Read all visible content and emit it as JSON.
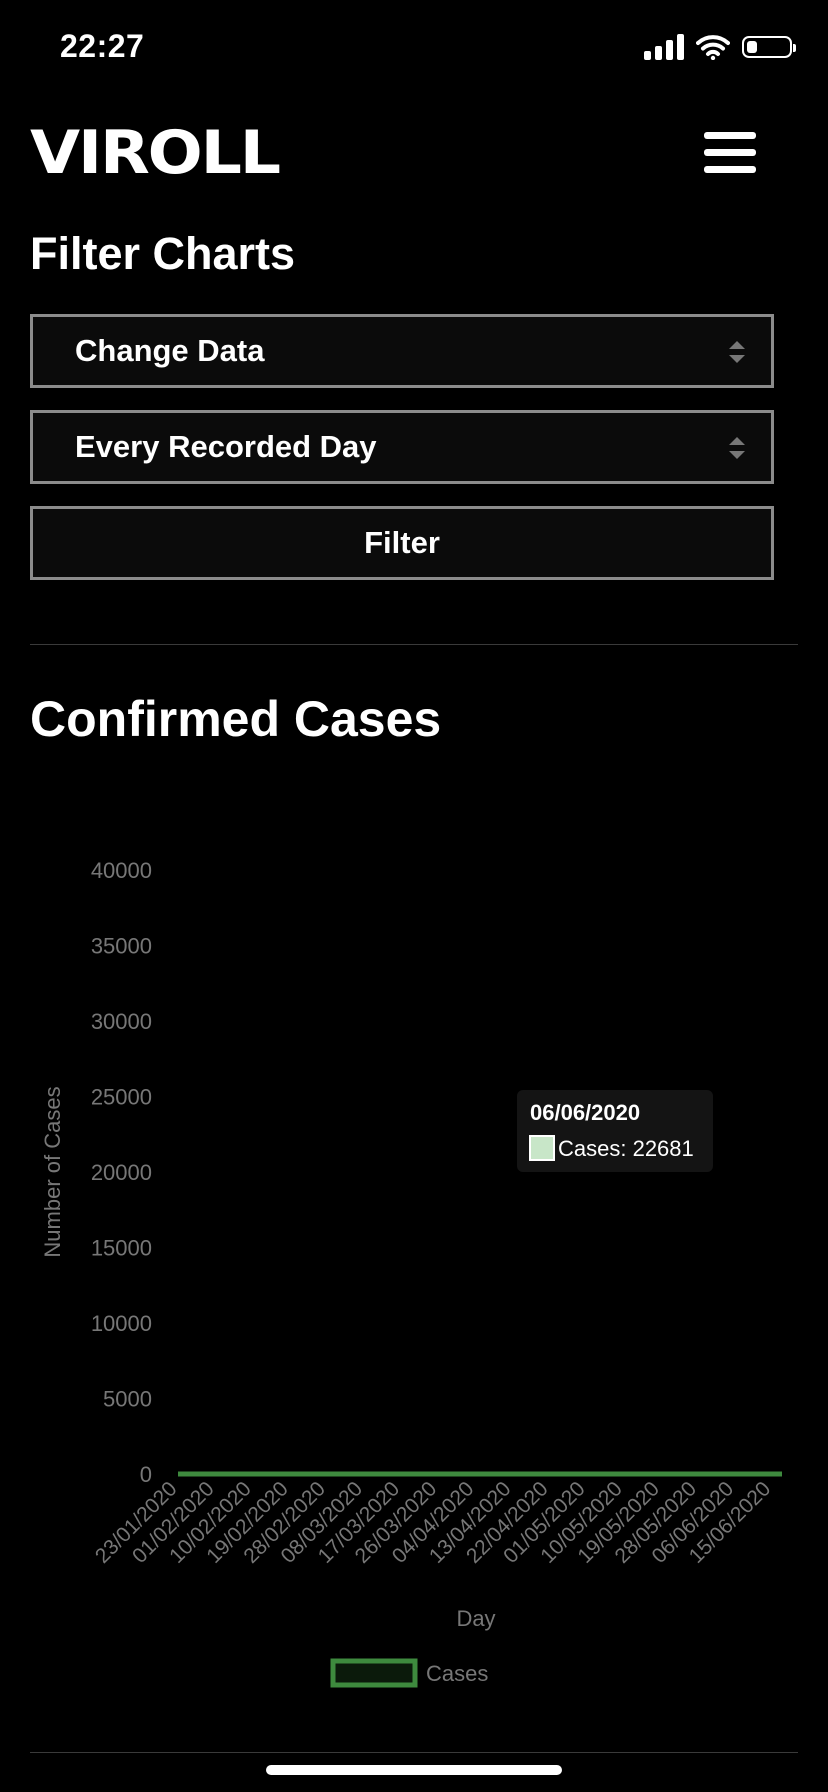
{
  "status": {
    "time": "22:27"
  },
  "header": {
    "logo": "VIROLL"
  },
  "filter": {
    "title": "Filter Charts",
    "data_select": "Change Data",
    "range_select": "Every Recorded Day",
    "button": "Filter"
  },
  "chart_title": "Confirmed Cases",
  "colors": {
    "line": "#3e8a3e",
    "fill": "#0b1a0b",
    "axis_text": "#777777",
    "tooltip_bg": "#141414"
  },
  "tooltip": {
    "date": "06/06/2020",
    "label": "Cases: 22681"
  },
  "chart_data": {
    "type": "area",
    "xlabel": "Day",
    "ylabel": "Number of Cases",
    "ylim": [
      0,
      40000
    ],
    "yticks": [
      0,
      5000,
      10000,
      15000,
      20000,
      25000,
      30000,
      35000,
      40000
    ],
    "xticks": [
      "23/01/2020",
      "01/02/2020",
      "10/02/2020",
      "19/02/2020",
      "28/02/2020",
      "08/03/2020",
      "17/03/2020",
      "26/03/2020",
      "04/04/2020",
      "13/04/2020",
      "22/04/2020",
      "01/05/2020",
      "10/05/2020",
      "19/05/2020",
      "28/05/2020",
      "06/06/2020",
      "15/06/2020"
    ],
    "grid": false,
    "legend_position": "bottom",
    "series": [
      {
        "name": "Cases",
        "x_start": "23/01/2020",
        "x_end": "18/06/2020",
        "values": [
          0,
          0,
          0,
          0,
          0,
          0,
          0,
          0,
          0,
          0,
          0,
          0,
          0,
          0,
          0,
          0,
          0,
          0,
          0,
          0,
          0,
          0,
          0,
          0,
          0,
          0,
          0,
          0,
          0,
          0,
          0,
          0,
          0,
          0,
          0,
          0,
          0,
          0,
          0,
          0,
          0,
          0,
          0,
          0,
          0,
          0,
          0,
          0,
          0,
          0,
          0,
          0,
          0,
          0,
          0,
          0,
          0,
          0,
          0,
          0,
          0,
          0,
          0,
          0,
          0,
          0,
          0,
          0,
          0,
          0,
          0,
          0,
          0,
          0,
          0,
          0,
          0,
          0,
          0,
          0,
          0,
          0,
          0,
          0,
          0,
          0,
          0,
          0,
          0,
          0,
          0,
          0,
          0,
          0,
          0,
          0,
          0,
          0,
          0,
          0,
          0,
          0,
          0,
          0,
          0,
          0,
          0,
          0,
          0,
          0,
          0,
          0,
          0,
          0,
          0,
          0,
          0,
          0,
          0,
          0,
          0,
          0,
          0,
          0,
          0,
          0,
          0,
          0,
          0,
          0,
          0,
          0,
          0,
          0,
          0,
          0,
          0,
          0,
          0,
          0,
          0,
          0,
          0,
          0,
          0,
          0,
          0,
          0
        ]
      }
    ]
  }
}
